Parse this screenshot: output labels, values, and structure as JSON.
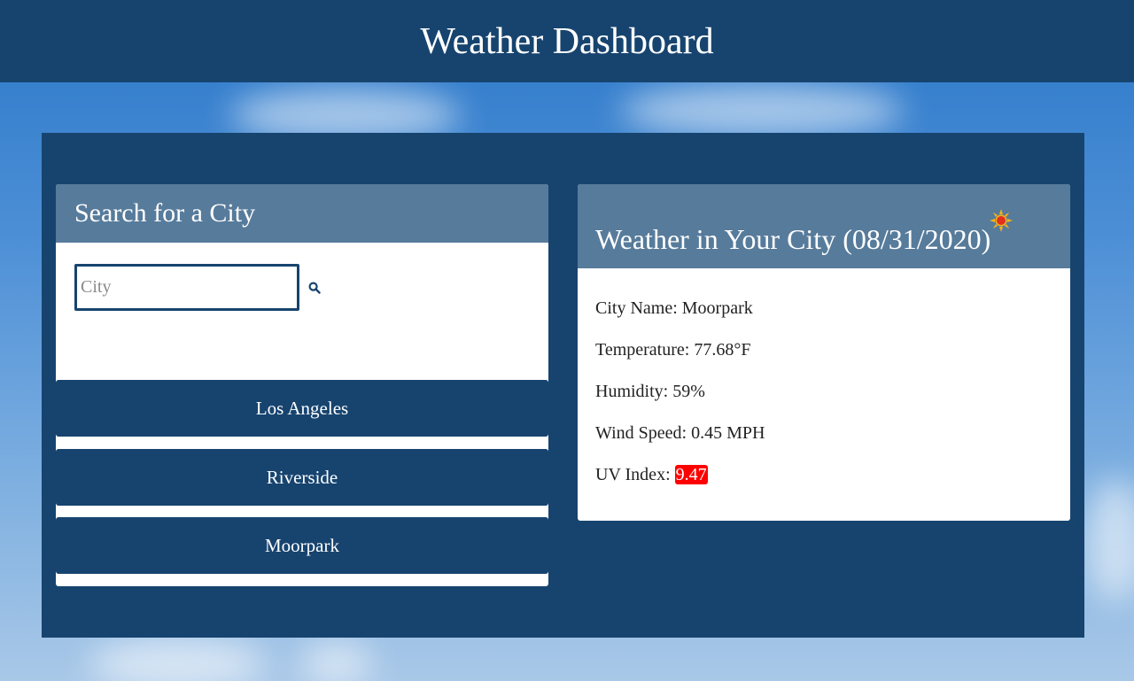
{
  "header": {
    "title": "Weather Dashboard"
  },
  "search": {
    "title": "Search for a City",
    "placeholder": "City",
    "search_icon": "search-icon",
    "history": [
      "Los Angeles",
      "Riverside",
      "Moorpark"
    ]
  },
  "weather": {
    "title": "Weather in Your City (08/31/2020)",
    "icon": "sun-icon",
    "city_line": "City Name: Moorpark",
    "temperature_line": "Temperature: 77.68°F",
    "humidity_line": "Humidity: 59%",
    "wind_line": "Wind Speed: 0.45 MPH",
    "uv_label": "UV Index: ",
    "uv_value": "9.47"
  },
  "colors": {
    "header_bg": "#17446f",
    "card_header_bg": "#577b9b",
    "uv_high": "#ff0000"
  }
}
